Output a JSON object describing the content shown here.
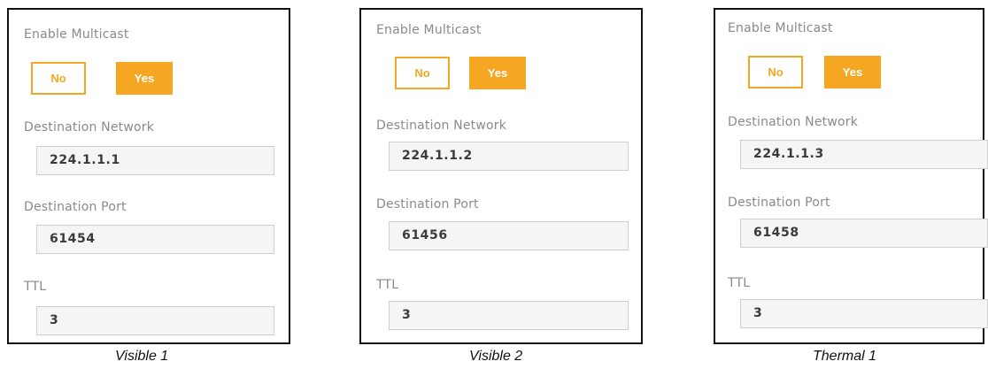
{
  "panels": [
    {
      "enable_multicast_label": "Enable Multicast",
      "no_label": "No",
      "yes_label": "Yes",
      "destination_network_label": "Destination Network",
      "destination_network_value": "224.1.1.1",
      "destination_port_label": "Destination Port",
      "destination_port_value": "61454",
      "ttl_label": "TTL",
      "ttl_value": "3",
      "caption": "Visible 1"
    },
    {
      "enable_multicast_label": "Enable Multicast",
      "no_label": "No",
      "yes_label": "Yes",
      "destination_network_label": "Destination Network",
      "destination_network_value": "224.1.1.2",
      "destination_port_label": "Destination Port",
      "destination_port_value": "61456",
      "ttl_label": "TTL",
      "ttl_value": "3",
      "caption": "Visible 2"
    },
    {
      "enable_multicast_label": "Enable Multicast",
      "no_label": "No",
      "yes_label": "Yes",
      "destination_network_label": "Destination Network",
      "destination_network_value": "224.1.1.3",
      "destination_port_label": "Destination Port",
      "destination_port_value": "61458",
      "ttl_label": "TTL",
      "ttl_value": "3",
      "caption": "Thermal 1"
    }
  ],
  "colors": {
    "accent": "#f5a623",
    "label": "#8a8a8a",
    "field_bg": "#f5f5f5"
  }
}
